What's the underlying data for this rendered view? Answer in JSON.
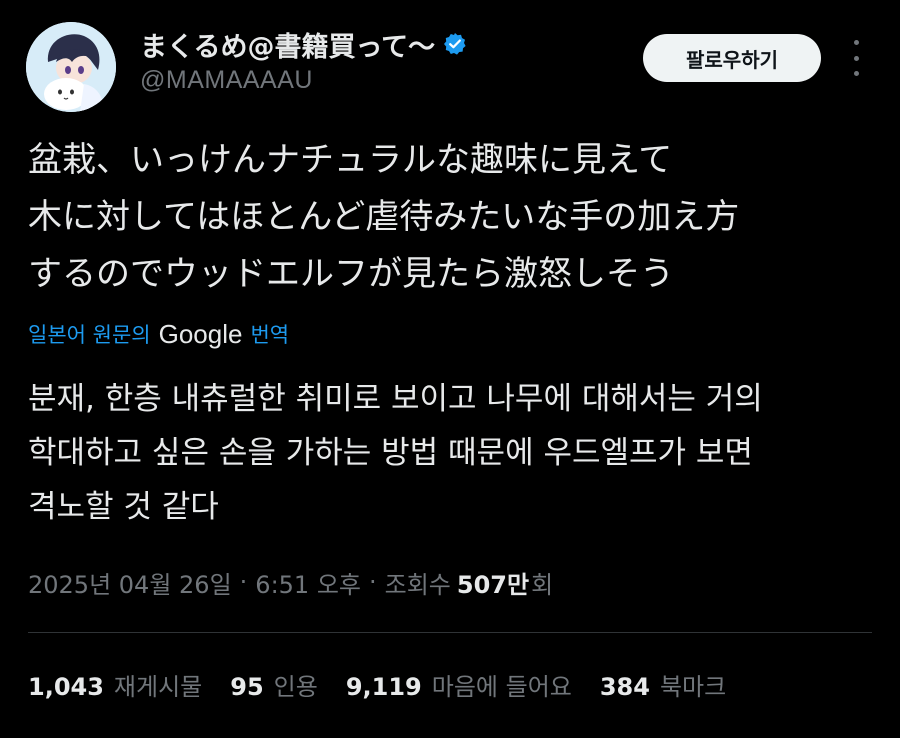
{
  "author": {
    "display_name": "まくるめ@書籍買って〜",
    "handle": "@MAMAAAAU",
    "avatar_icon": "avatar-illustration",
    "verified_icon": "verified-badge-icon",
    "verified_color": "#1d9bf0"
  },
  "header": {
    "follow_label": "팔로우하기",
    "more_icon": "more-vertical-icon"
  },
  "tweet": {
    "lines": [
      "盆栽、いっけんナチュラルな趣味に見えて",
      "木に対してはほとんど虐待みたいな手の加え方",
      "するのでウッドエルフが見たら激怒しそう"
    ]
  },
  "translation": {
    "prefix": "일본어 원문의",
    "provider": "Google",
    "suffix": "번역",
    "lines": [
      "분재, 한층 내츄럴한 취미로 보이고 나무에 대해서는 거의",
      "학대하고 싶은 손을 가하는 방법 때문에 우드엘프가 보면",
      "격노할 것 같다"
    ]
  },
  "meta": {
    "date": "2025년 04월 26일",
    "time": "6:51 오후",
    "views_label": "조회수",
    "views_count": "507만",
    "views_suffix": "회",
    "separator": "·"
  },
  "stats": [
    {
      "count": "1,043",
      "label": "재게시물"
    },
    {
      "count": "95",
      "label": "인용"
    },
    {
      "count": "9,119",
      "label": "마음에 들어요"
    },
    {
      "count": "384",
      "label": "북마크"
    }
  ],
  "colors": {
    "background": "#000000",
    "text_primary": "#e7e9ea",
    "text_secondary": "#71767b",
    "link": "#1d9bf0",
    "divider": "#2f3336",
    "button_bg": "#eff3f4"
  }
}
